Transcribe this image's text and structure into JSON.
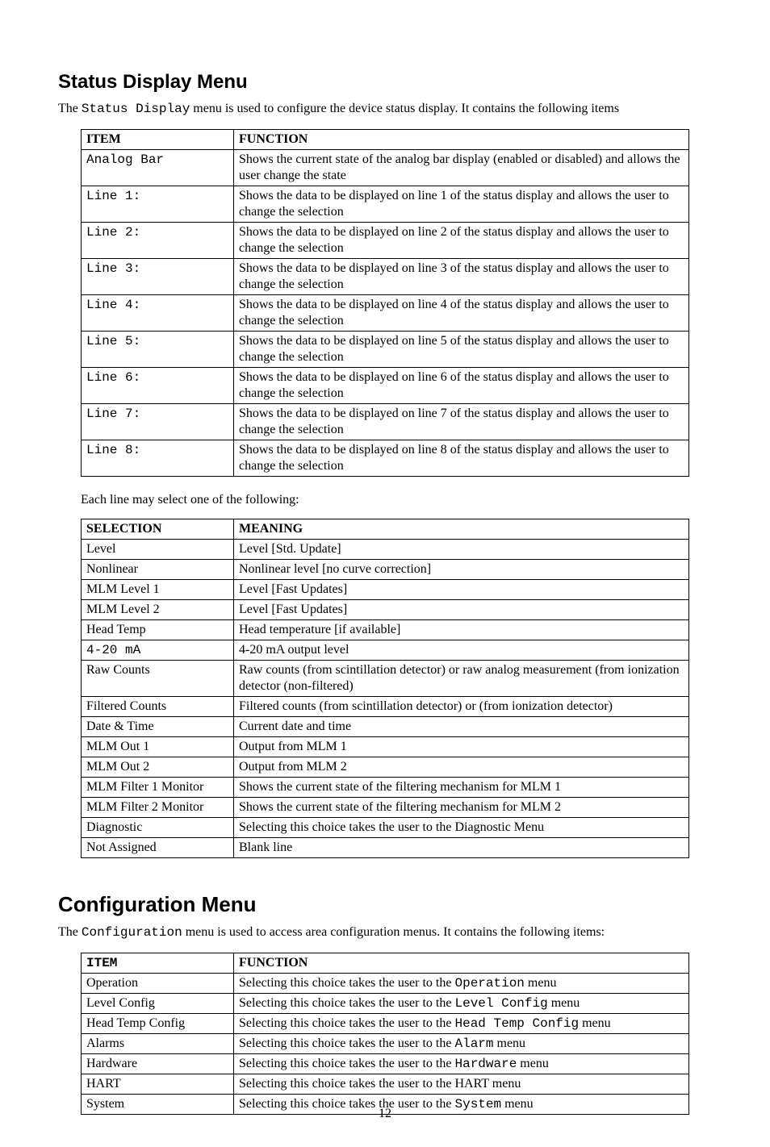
{
  "section1": {
    "heading": "Status Display Menu",
    "intro_prefix": "The ",
    "intro_mono": "Status Display",
    "intro_suffix": " menu is used to configure the device status display. It contains the following items",
    "table1": {
      "head_item": "ITEM",
      "head_function": "FUNCTION",
      "rows": [
        {
          "item": "Analog Bar",
          "item_mono": true,
          "func_parts": [
            {
              "t": "Shows the current state of the analog bar display (enabled or disabled) and allows the user change the state"
            }
          ]
        },
        {
          "item": "Line 1:",
          "item_mono": true,
          "func_parts": [
            {
              "t": "Shows the data to be displayed on line 1 of the status display and allows the user to change the selection"
            }
          ]
        },
        {
          "item": "Line 2:",
          "item_mono": true,
          "func_parts": [
            {
              "t": "Shows the data to be displayed on line 2 of the status display and allows the user to change the selection"
            }
          ]
        },
        {
          "item": "Line 3:",
          "item_mono": true,
          "func_parts": [
            {
              "t": "Shows the data to be displayed on line 3 of the status display and allows the user to change the selection"
            }
          ]
        },
        {
          "item": "Line 4:",
          "item_mono": true,
          "func_parts": [
            {
              "t": "Shows the data to be displayed on line 4 of the status display and allows the user to change the selection"
            }
          ]
        },
        {
          "item": "Line 5:",
          "item_mono": true,
          "func_parts": [
            {
              "t": "Shows the data to be displayed on line 5 of the status display and allows the user to change the selection"
            }
          ]
        },
        {
          "item": "Line 6:",
          "item_mono": true,
          "func_parts": [
            {
              "t": "Shows the data to be displayed on line 6 of the status display and allows the user to change the selection"
            }
          ]
        },
        {
          "item": "Line 7:",
          "item_mono": true,
          "func_parts": [
            {
              "t": "Shows the data to be displayed on line 7 of the status display and allows the user to change the selection"
            }
          ]
        },
        {
          "item": "Line 8:",
          "item_mono": true,
          "func_parts": [
            {
              "t": "Shows the data to be displayed on line 8 of the status display and allows the user to change the selection"
            }
          ]
        }
      ]
    },
    "mid_para": "Each line may select one of the following:",
    "table2": {
      "head_selection": "SELECTION",
      "head_meaning": "MEANING",
      "rows": [
        {
          "sel": "Level",
          "sel_mono": false,
          "mean_parts": [
            {
              "t": "Level [Std. Update]"
            }
          ]
        },
        {
          "sel": "Nonlinear",
          "sel_mono": false,
          "mean_parts": [
            {
              "t": "Nonlinear level [no curve correction]"
            }
          ]
        },
        {
          "sel": "MLM Level 1",
          "sel_mono": false,
          "mean_parts": [
            {
              "t": "Level [Fast Updates]"
            }
          ]
        },
        {
          "sel": "MLM Level 2",
          "sel_mono": false,
          "mean_parts": [
            {
              "t": "Level [Fast Updates]"
            }
          ]
        },
        {
          "sel": "Head Temp",
          "sel_mono": false,
          "mean_parts": [
            {
              "t": "Head temperature [if available]"
            }
          ]
        },
        {
          "sel": "4-20 mA",
          "sel_mono": true,
          "mean_parts": [
            {
              "t": "4-20 mA output level"
            }
          ]
        },
        {
          "sel": "Raw Counts",
          "sel_mono": false,
          "mean_parts": [
            {
              "t": "Raw counts (from scintillation detector) or raw analog measurement (from ionization detector (non-filtered)"
            }
          ]
        },
        {
          "sel": "Filtered Counts",
          "sel_mono": false,
          "mean_parts": [
            {
              "t": "Filtered counts (from scintillation detector) or (from ionization detector)"
            }
          ]
        },
        {
          "sel": "Date & Time",
          "sel_mono": false,
          "mean_parts": [
            {
              "t": "Current date and time"
            }
          ]
        },
        {
          "sel": "MLM Out 1",
          "sel_mono": false,
          "mean_parts": [
            {
              "t": "Output from MLM 1"
            }
          ]
        },
        {
          "sel": "MLM Out 2",
          "sel_mono": false,
          "mean_parts": [
            {
              "t": "Output from MLM 2"
            }
          ]
        },
        {
          "sel": "MLM Filter 1 Monitor",
          "sel_mono": false,
          "mean_parts": [
            {
              "t": "Shows the current state of the filtering mechanism for MLM 1"
            }
          ]
        },
        {
          "sel": "MLM Filter 2 Monitor",
          "sel_mono": false,
          "mean_parts": [
            {
              "t": "Shows the current state of the filtering mechanism for MLM 2"
            }
          ]
        },
        {
          "sel": "Diagnostic",
          "sel_mono": false,
          "mean_parts": [
            {
              "t": "Selecting this choice takes the user to the Diagnostic Menu"
            }
          ]
        },
        {
          "sel": "Not Assigned",
          "sel_mono": false,
          "mean_parts": [
            {
              "t": "Blank line"
            }
          ]
        }
      ]
    }
  },
  "section2": {
    "heading": "Configuration Menu",
    "intro_prefix": "The ",
    "intro_mono": "Configuration",
    "intro_suffix": " menu is used to access area configuration menus. It contains the following items:",
    "table3": {
      "head_item": "ITEM",
      "head_function": "FUNCTION",
      "rows": [
        {
          "item": "Operation",
          "func_parts": [
            {
              "t": "Selecting this choice takes the user to the "
            },
            {
              "t": "Operation",
              "mono": true
            },
            {
              "t": " menu"
            }
          ]
        },
        {
          "item": "Level Config",
          "func_parts": [
            {
              "t": "Selecting this choice takes the user to the "
            },
            {
              "t": "Level Config",
              "mono": true
            },
            {
              "t": " menu"
            }
          ]
        },
        {
          "item": "Head Temp Config",
          "func_parts": [
            {
              "t": "Selecting this choice takes the user to the "
            },
            {
              "t": "Head Temp Config",
              "mono": true
            },
            {
              "t": " menu"
            }
          ]
        },
        {
          "item": "Alarms",
          "func_parts": [
            {
              "t": "Selecting this choice takes the user to the "
            },
            {
              "t": "Alarm",
              "mono": true
            },
            {
              "t": " menu"
            }
          ]
        },
        {
          "item": "Hardware",
          "func_parts": [
            {
              "t": "Selecting this choice takes the user to the "
            },
            {
              "t": "Hardware",
              "mono": true
            },
            {
              "t": " menu"
            }
          ]
        },
        {
          "item": "HART",
          "func_parts": [
            {
              "t": "Selecting this choice takes the user to the HART menu"
            }
          ]
        },
        {
          "item": "System",
          "func_parts": [
            {
              "t": "Selecting this choice takes the user to the "
            },
            {
              "t": "System",
              "mono": true
            },
            {
              "t": " menu"
            }
          ]
        }
      ]
    }
  },
  "page_number": "12"
}
